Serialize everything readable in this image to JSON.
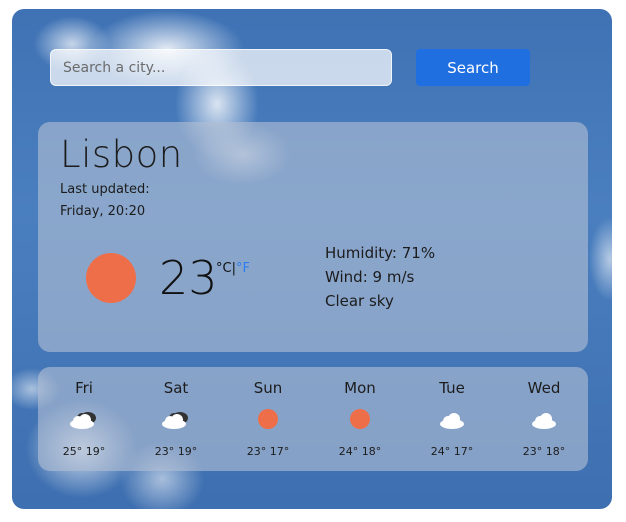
{
  "search": {
    "placeholder": "Search a city...",
    "button_label": "Search"
  },
  "current": {
    "city": "Lisbon",
    "updated_label": "Last updated:",
    "updated_time": "Friday, 20:20",
    "icon": "sun-icon",
    "temperature": "23",
    "unit_c": "°C",
    "unit_sep": "|",
    "unit_f": "°F",
    "humidity": "Humidity: 71%",
    "wind": "Wind: 9 m/s",
    "condition": "Clear sky"
  },
  "forecast": [
    {
      "day": "Fri",
      "icon": "dark-cloud-icon",
      "temps": "25° 19°"
    },
    {
      "day": "Sat",
      "icon": "dark-cloud-icon",
      "temps": "23° 19°"
    },
    {
      "day": "Sun",
      "icon": "sun-icon",
      "temps": "23° 17°"
    },
    {
      "day": "Mon",
      "icon": "sun-icon",
      "temps": "24° 18°"
    },
    {
      "day": "Tue",
      "icon": "cloud-icon",
      "temps": "24° 17°"
    },
    {
      "day": "Wed",
      "icon": "cloud-icon",
      "temps": "23° 18°"
    }
  ],
  "colors": {
    "accent": "#1f6fe0",
    "sun": "#ef6e4a",
    "unit_link": "#2d7cf0"
  }
}
